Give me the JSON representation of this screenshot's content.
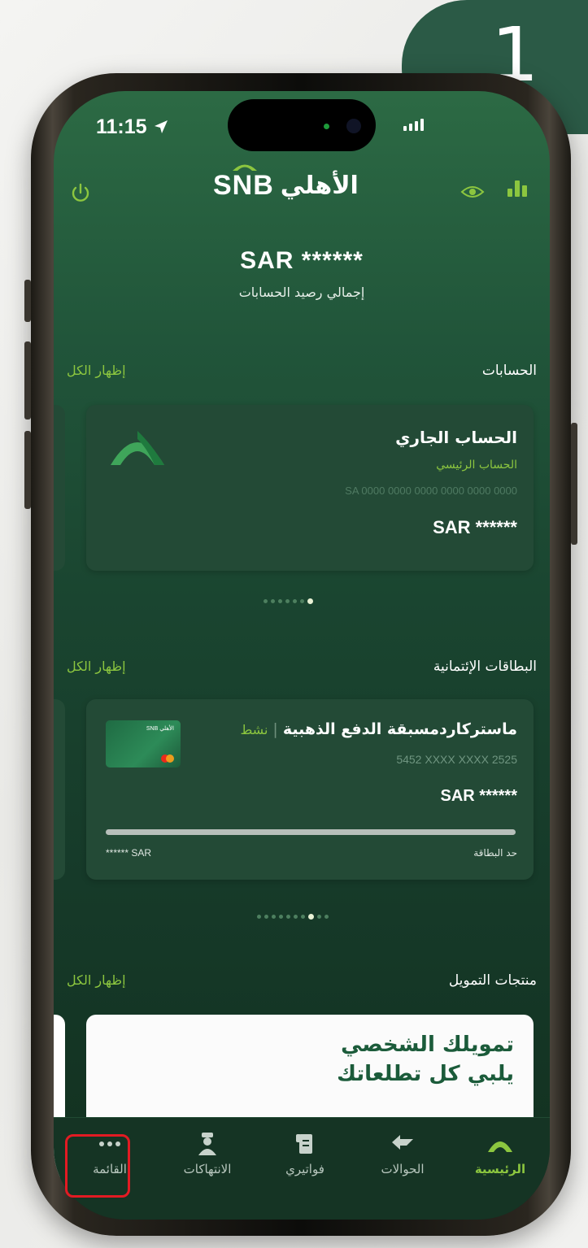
{
  "step_badge": "1",
  "status": {
    "time": "11:15"
  },
  "header": {
    "logo_latin": "SNB",
    "logo_arabic": "الأهلي"
  },
  "balance": {
    "amount": "SAR ******",
    "label": "إجمالي رصيد الحسابات"
  },
  "accounts": {
    "title": "الحسابات",
    "show_all": "إظهار الكل",
    "card": {
      "name": "الحساب الجاري",
      "subtitle": "الحساب الرئيسي",
      "iban": "SA 0000 0000 0000 0000 0000 0000",
      "balance": "SAR ******"
    },
    "pager_count": 7,
    "pager_active": 6
  },
  "credit_cards": {
    "title": "البطاقات الإئتمانية",
    "show_all": "إظهار الكل",
    "card": {
      "name": "ماستركاردمسبقة الدفع الذهبية",
      "status": "نشط",
      "number": "5452 XXXX XXXX 2525",
      "balance": "SAR ******",
      "limit_label": "حد البطاقة",
      "limit_value": "****** SAR",
      "image_logo": "SNB الأهلي"
    },
    "pager_count": 10,
    "pager_active": 7
  },
  "financing": {
    "title": "منتجات التمويل",
    "show_all": "إظهار الكل",
    "promo_line1": "تمويلك الشخصي",
    "promo_line2": "يلبي كل تطلعاتك"
  },
  "tabbar": {
    "items": [
      {
        "label": "الرئيسية",
        "icon": "home-arch-icon",
        "active": true
      },
      {
        "label": "الحوالات",
        "icon": "transfer-arrow-icon",
        "active": false
      },
      {
        "label": "فواتيري",
        "icon": "bill-icon",
        "active": false
      },
      {
        "label": "الانتهاكات",
        "icon": "officer-icon",
        "active": false
      },
      {
        "label": "القائمة",
        "icon": "more-dots-icon",
        "active": false
      }
    ]
  },
  "colors": {
    "accent": "#8cc63f",
    "highlight": "#e21b23",
    "badge": "#2b5a46"
  }
}
